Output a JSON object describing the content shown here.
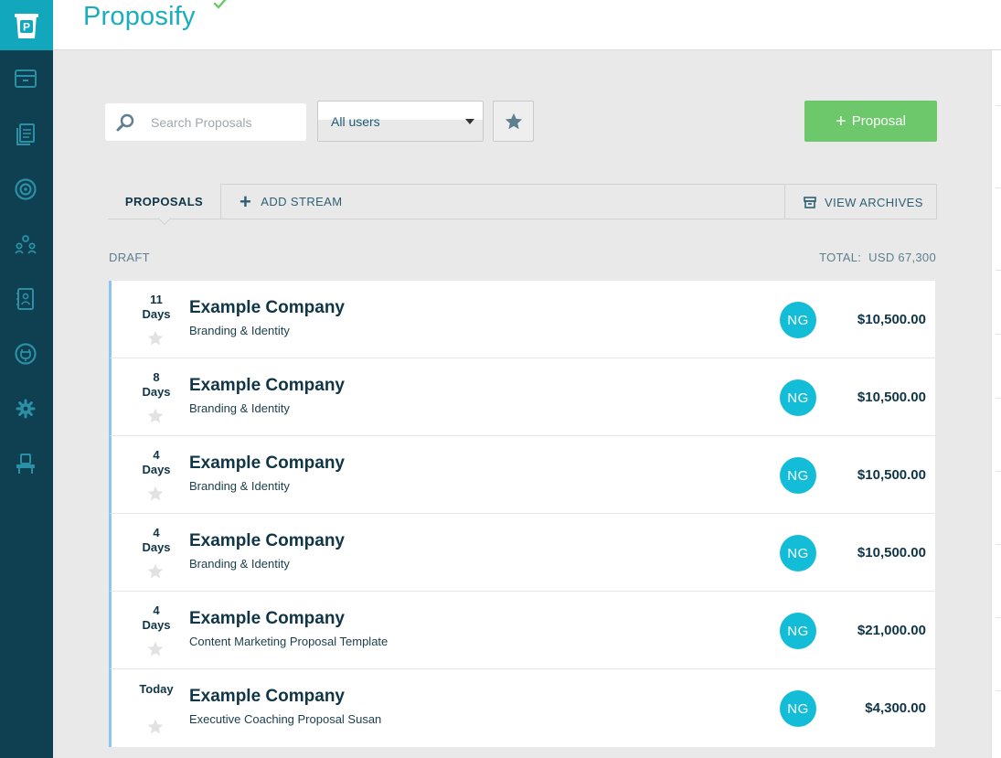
{
  "app": {
    "brand": "Proposify",
    "logo_letter": "P"
  },
  "colors": {
    "sidebar": "#0e4052",
    "accent": "#12a7bc",
    "primary_button": "#6cc86b",
    "avatar": "#13bcd7",
    "row_marker": "#8ac6f0"
  },
  "sidebar": {
    "items": [
      {
        "icon": "archive-icon"
      },
      {
        "icon": "documents-icon"
      },
      {
        "icon": "target-icon"
      },
      {
        "icon": "team-icon"
      },
      {
        "icon": "contacts-icon"
      },
      {
        "icon": "plug-icon"
      },
      {
        "icon": "gear-icon"
      },
      {
        "icon": "desk-icon"
      }
    ]
  },
  "toolbar": {
    "search_placeholder": "Search Proposals",
    "user_filter": "All users",
    "new_proposal_plus": "+",
    "new_proposal_label": "Proposal"
  },
  "tabs": {
    "proposals": "PROPOSALS",
    "add_stream_plus": "+",
    "add_stream": "ADD STREAM",
    "view_archives": "VIEW ARCHIVES"
  },
  "section": {
    "label": "DRAFT",
    "total_label": "TOTAL:",
    "total_value": "USD 67,300"
  },
  "proposals": [
    {
      "days_num": "11",
      "days_unit": "Days",
      "company": "Example Company",
      "title": "Branding & Identity",
      "initials": "NG",
      "amount": "$10,500.00"
    },
    {
      "days_num": "8",
      "days_unit": "Days",
      "company": "Example Company",
      "title": "Branding & Identity",
      "initials": "NG",
      "amount": "$10,500.00"
    },
    {
      "days_num": "4",
      "days_unit": "Days",
      "company": "Example Company",
      "title": "Branding & Identity",
      "initials": "NG",
      "amount": "$10,500.00"
    },
    {
      "days_num": "4",
      "days_unit": "Days",
      "company": "Example Company",
      "title": "Branding & Identity",
      "initials": "NG",
      "amount": "$10,500.00"
    },
    {
      "days_num": "4",
      "days_unit": "Days",
      "company": "Example Company",
      "title": "Content Marketing Proposal Template",
      "initials": "NG",
      "amount": "$21,000.00"
    },
    {
      "days_num": "Today",
      "days_unit": "",
      "company": "Example Company",
      "title": "Executive Coaching Proposal Susan",
      "initials": "NG",
      "amount": "$4,300.00"
    }
  ]
}
